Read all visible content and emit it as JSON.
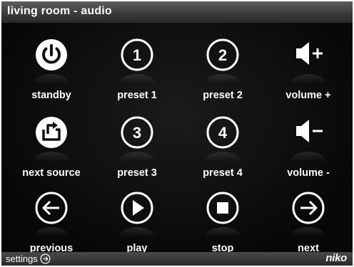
{
  "header": {
    "title": "living room - audio"
  },
  "buttons": {
    "standby": {
      "label": "standby",
      "icon": "power-icon"
    },
    "preset1": {
      "label": "preset 1",
      "number": "1",
      "icon": "number-circle-icon"
    },
    "preset2": {
      "label": "preset 2",
      "number": "2",
      "icon": "number-circle-icon"
    },
    "volume_up": {
      "label": "volume +",
      "icon": "speaker-plus-icon"
    },
    "next_source": {
      "label": "next source",
      "icon": "source-switch-icon"
    },
    "preset3": {
      "label": "preset 3",
      "number": "3",
      "icon": "number-circle-icon"
    },
    "preset4": {
      "label": "preset 4",
      "number": "4",
      "icon": "number-circle-icon"
    },
    "volume_down": {
      "label": "volume -",
      "icon": "speaker-minus-icon"
    },
    "previous": {
      "label": "previous",
      "icon": "arrow-left-circle-icon"
    },
    "play": {
      "label": "play",
      "icon": "play-circle-icon"
    },
    "stop": {
      "label": "stop",
      "icon": "stop-circle-icon"
    },
    "next": {
      "label": "next",
      "icon": "arrow-right-circle-icon"
    }
  },
  "footer": {
    "settings_label": "settings",
    "settings_icon": "arrow-right-circle-icon",
    "brand": "niko"
  },
  "colors": {
    "background": "#0b0b0b",
    "foreground": "#ffffff",
    "titlebar": "#3b3b3b"
  }
}
